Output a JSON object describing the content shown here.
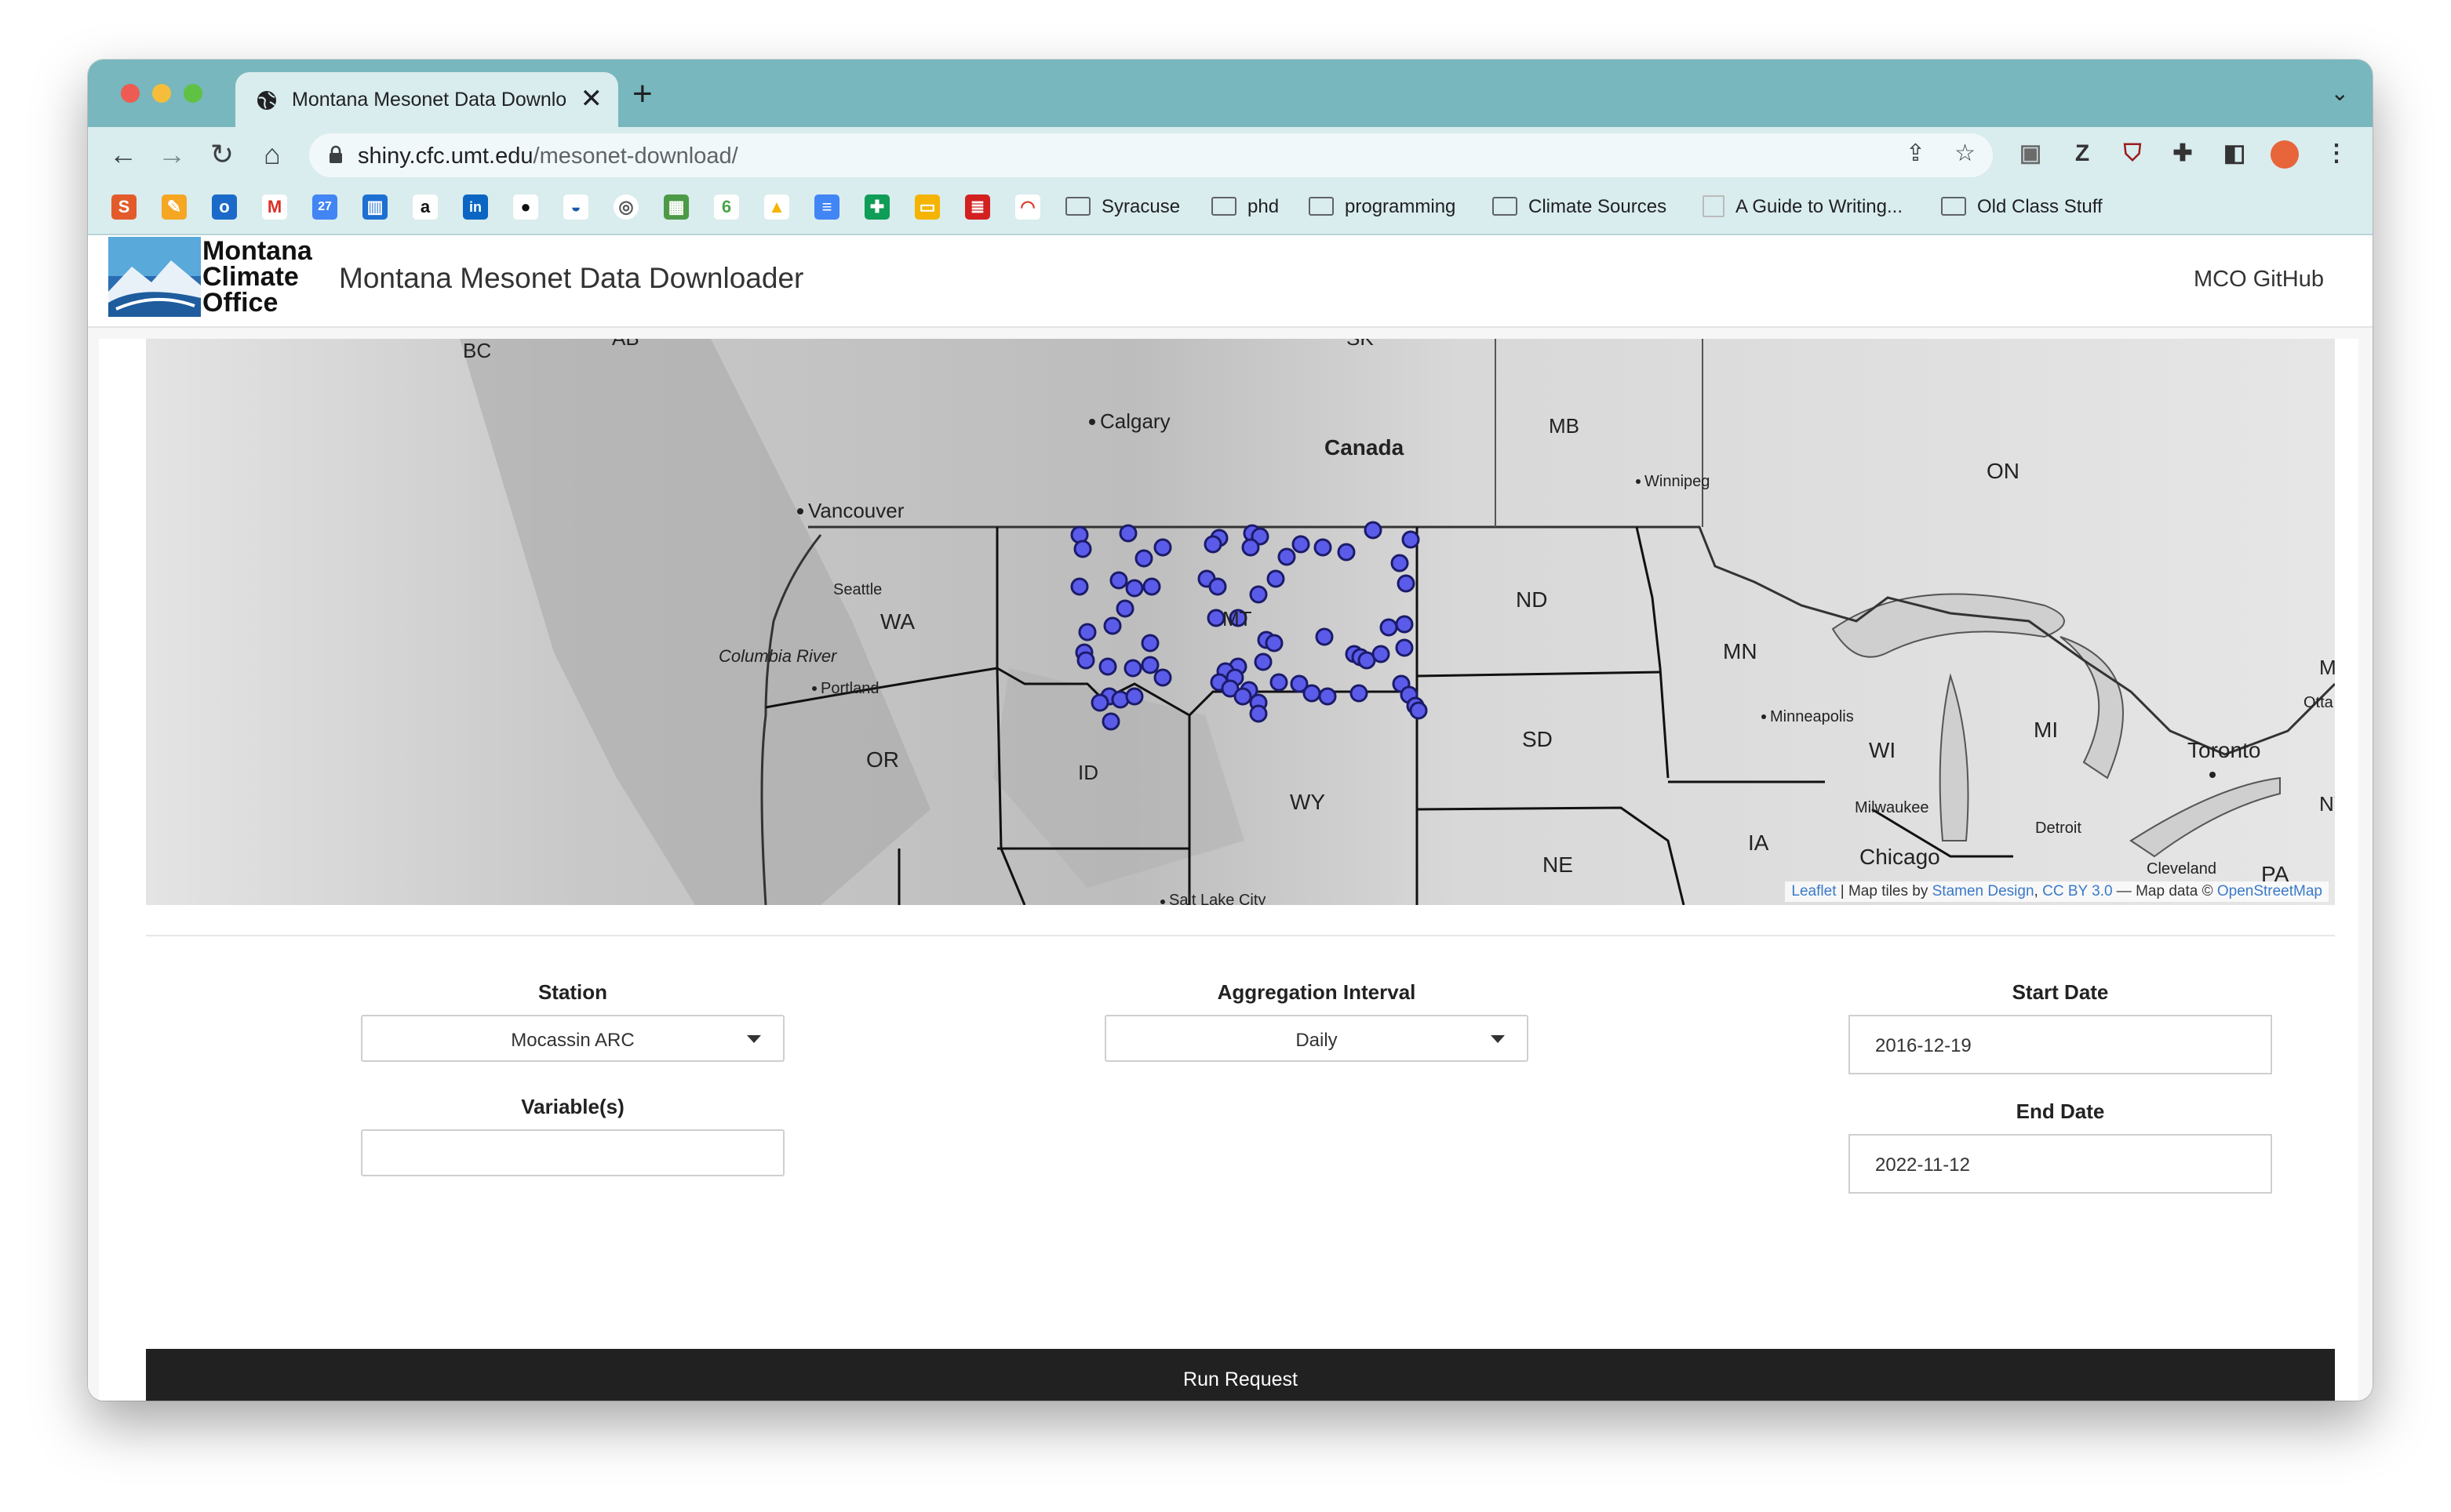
{
  "browser": {
    "tab_title": "Montana Mesonet Data Downloa",
    "new_tab": "+",
    "close": "✕",
    "url_host": "shiny.cfc.umt.edu",
    "url_path": "/mesonet-download/",
    "bookmarks": [
      {
        "label": "Syracuse"
      },
      {
        "label": "phd"
      },
      {
        "label": "programming"
      },
      {
        "label": "Climate Sources"
      },
      {
        "label": "A Guide to Writing..."
      },
      {
        "label": "Old Class Stuff"
      }
    ]
  },
  "header": {
    "logo_text": "Montana Climate Office",
    "title": "Montana Mesonet Data Downloader",
    "github": "MCO GitHub"
  },
  "map": {
    "labels": {
      "bc": "BC",
      "ab": "AB",
      "sk": "SK",
      "mb": "MB",
      "on": "ON",
      "canada": "Canada",
      "calgary": "Calgary",
      "winnipeg": "Winnipeg",
      "vancouver": "Vancouver",
      "seattle": "Seattle",
      "wa": "WA",
      "columbia": "Columbia River",
      "portland": "Portland",
      "or": "OR",
      "id": "ID",
      "mt": "MT",
      "nd": "ND",
      "sd": "SD",
      "wy": "WY",
      "ne": "NE",
      "mn": "MN",
      "minneapolis": "Minneapolis",
      "wi": "WI",
      "milwaukee": "Milwaukee",
      "mi": "MI",
      "detroit": "Detroit",
      "ia": "IA",
      "chicago": "Chicago",
      "toronto": "Toronto",
      "cleveland": "Cleveland",
      "pa": "PA",
      "saltlake": "Salt Lake City",
      "ottawa": "Otta",
      "m": "M",
      "ny": "NY"
    },
    "attribution": {
      "leaflet": "Leaflet",
      "sep1": " | Map tiles by ",
      "stamen": "Stamen Design",
      "sep2": ", ",
      "ccby": "CC BY 3.0",
      "sep3": " — Map data © ",
      "osm": "OpenStreetMap"
    },
    "marker_color": "#5b5bea"
  },
  "form": {
    "station_label": "Station",
    "station_value": "Mocassin ARC",
    "aggregation_label": "Aggregation Interval",
    "aggregation_value": "Daily",
    "start_label": "Start Date",
    "start_value": "2016-12-19",
    "variables_label": "Variable(s)",
    "variables_value": "",
    "end_label": "End Date",
    "end_value": "2022-11-12",
    "run_button": "Run Request"
  }
}
